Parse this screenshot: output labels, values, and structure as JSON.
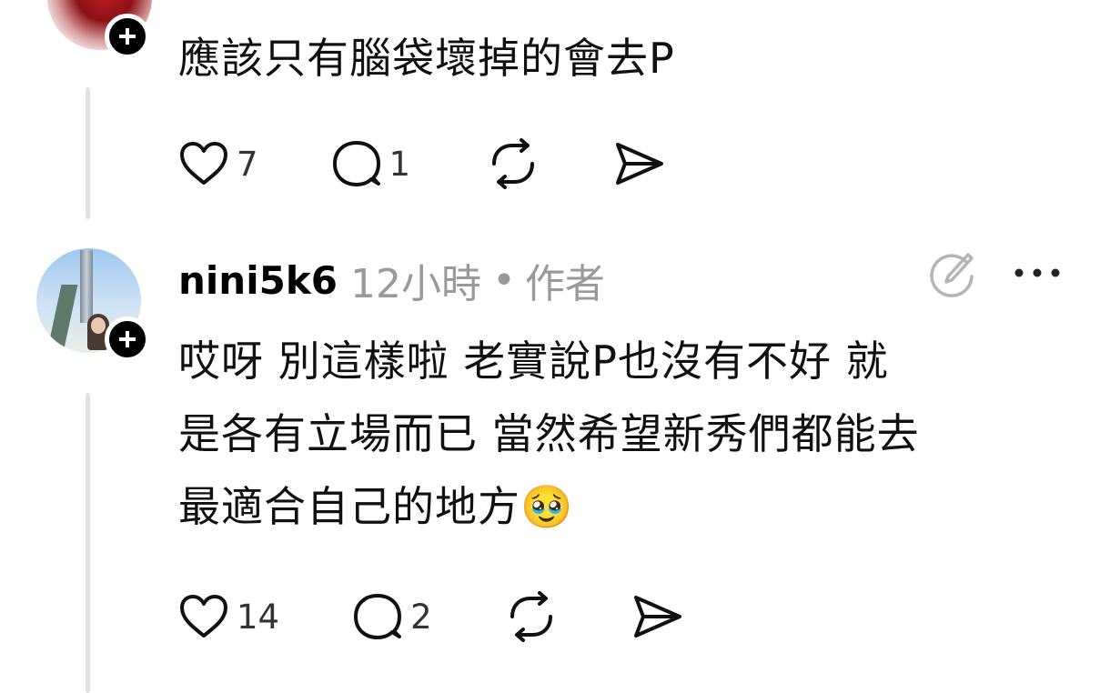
{
  "comments": [
    {
      "text": "應該只有腦袋壞掉的會去P",
      "likes": "7",
      "replies": "1"
    },
    {
      "username": "nini5k6",
      "time": "12小時",
      "separator": "•",
      "role": "作者",
      "text_lines": [
        "哎呀 別這樣啦 老實說P也沒有不好 就",
        "是各有立場而已 當然希望新秀們都能去",
        "最適合自己的地方🥹"
      ],
      "likes": "14",
      "replies": "2"
    }
  ],
  "icons": {
    "like": "heart-icon",
    "reply": "comment-bubble-icon",
    "repost": "repost-icon",
    "share": "send-icon",
    "edit": "edit-circle-icon",
    "more": "more-dots-icon",
    "follow": "follow-plus-icon"
  }
}
